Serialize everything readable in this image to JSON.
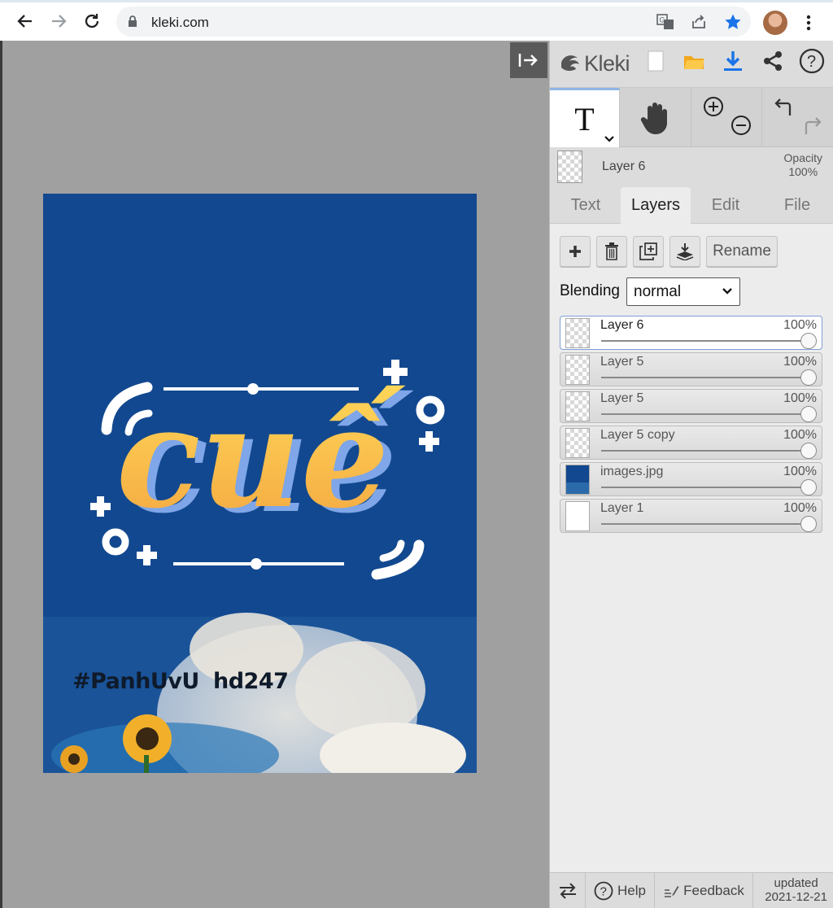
{
  "browser": {
    "url": "kleki.com",
    "icons": [
      "back-icon",
      "forward-icon",
      "reload-icon",
      "lock-icon",
      "translate-icon",
      "share-icon",
      "star-icon",
      "avatar",
      "menu-icon"
    ]
  },
  "app": {
    "brand": "Kleki",
    "toolbar_icons": [
      "new-file-icon",
      "open-folder-icon",
      "download-icon",
      "share-icon",
      "help-icon"
    ]
  },
  "tools": {
    "text_tool": "T",
    "icons": [
      "text-tool-icon",
      "hand-tool-icon",
      "zoom-in-icon",
      "zoom-out-icon",
      "undo-icon",
      "redo-icon"
    ]
  },
  "current_layer": {
    "name": "Layer 6",
    "opacity_label": "Opacity",
    "opacity_value": "100%"
  },
  "tabs": [
    {
      "label": "Text"
    },
    {
      "label": "Layers"
    },
    {
      "label": "Edit"
    },
    {
      "label": "File"
    }
  ],
  "layers_panel": {
    "rename_label": "Rename",
    "blending_label": "Blending",
    "blending_value": "normal",
    "layers": [
      {
        "name": "Layer 6",
        "opacity": "100%",
        "selected": true
      },
      {
        "name": "Layer 5",
        "opacity": "100%",
        "selected": false
      },
      {
        "name": "Layer 5",
        "opacity": "100%",
        "selected": false
      },
      {
        "name": "Layer 5 copy",
        "opacity": "100%",
        "selected": false
      },
      {
        "name": "images.jpg",
        "opacity": "100%",
        "selected": false
      },
      {
        "name": "Layer 1",
        "opacity": "100%",
        "selected": false
      }
    ]
  },
  "artwork": {
    "title_text": "cuế",
    "caption_left": "#PanhUvU",
    "caption_right": "hd247"
  },
  "footer": {
    "help": "Help",
    "feedback": "Feedback",
    "updated_label": "updated",
    "updated_date": "2021-12-21"
  },
  "colors": {
    "accent_blue": "#1a73e8",
    "art_background": "#12488f",
    "lettering_orange": "#f6b944"
  }
}
